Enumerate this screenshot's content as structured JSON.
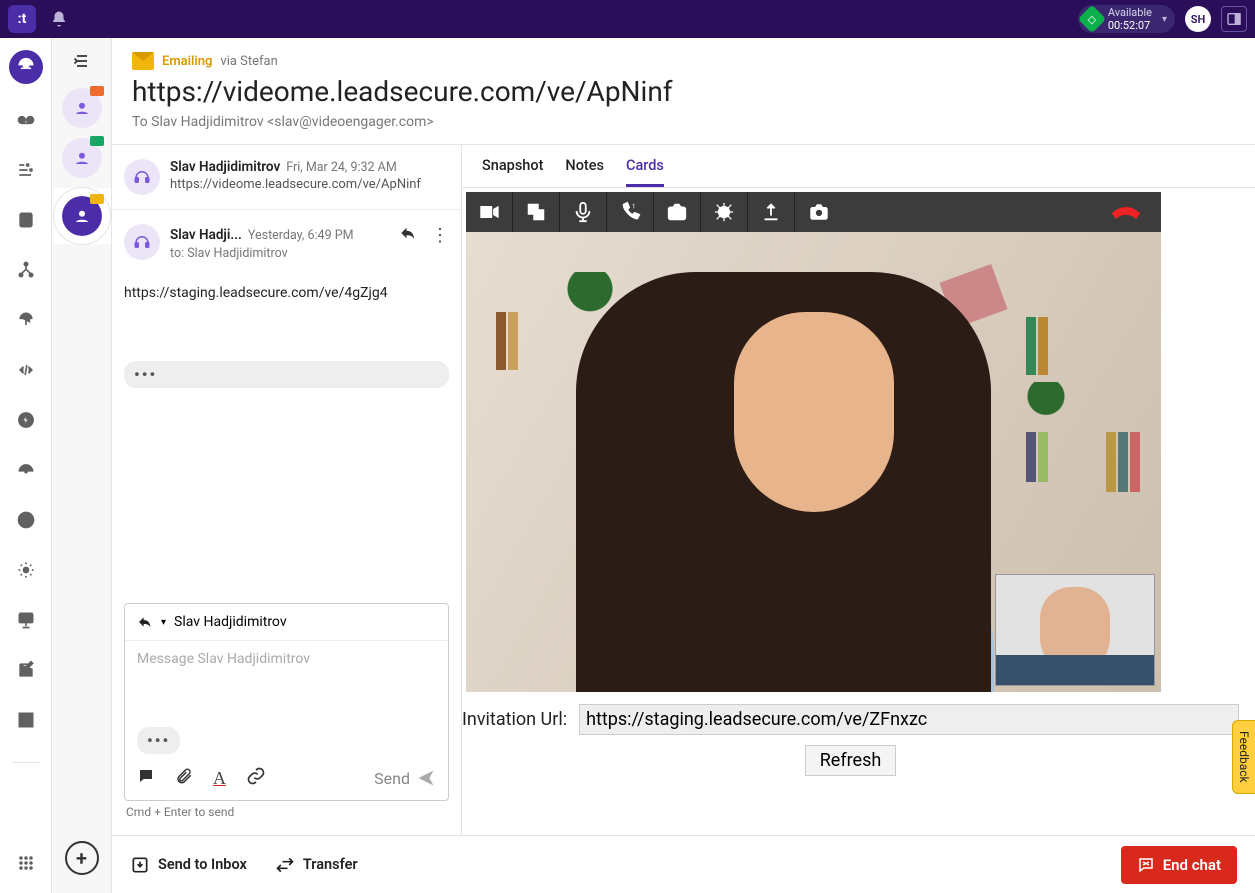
{
  "topbar": {
    "status_label": "Available",
    "timer": "00:52:07",
    "user_initials": "SH"
  },
  "header": {
    "channel_label": "Emailing",
    "via_label": "via Stefan",
    "title": "https://videome.leadsecure.com/ve/ApNinf",
    "to_line": "To Slav Hadjidimitrov <slav@videoengager.com>"
  },
  "tabs": {
    "snapshot": "Snapshot",
    "notes": "Notes",
    "cards": "Cards"
  },
  "messages": [
    {
      "from": "Slav Hadjidimitrov",
      "time": "Fri, Mar 24, 9:32 AM",
      "body": "https://videome.leadsecure.com/ve/ApNinf"
    },
    {
      "from": "Slav Hadji...",
      "time": "Yesterday, 6:49 PM",
      "to_line": "to: Slav Hadjidimitrov",
      "body": "https://staging.leadsecure.com/ve/4gZjg4"
    }
  ],
  "composer": {
    "reply_to_name": "Slav Hadjidimitrov",
    "placeholder": "Message Slav Hadjidimitrov",
    "send_label": "Send",
    "hint": "Cmd + Enter to send"
  },
  "video": {
    "invitation_label": "Invitation Url:",
    "invitation_url": "https://staging.leadsecure.com/ve/ZFnxzc",
    "refresh_label": "Refresh"
  },
  "footer": {
    "send_to_inbox": "Send to Inbox",
    "transfer": "Transfer",
    "end_chat": "End chat"
  },
  "feedback": {
    "label": "Feedback"
  }
}
